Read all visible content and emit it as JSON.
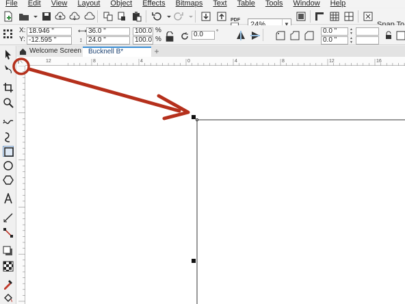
{
  "menu": [
    {
      "label": "File",
      "u": true
    },
    {
      "label": "Edit",
      "u": true
    },
    {
      "label": "View",
      "u": true
    },
    {
      "label": "Layout",
      "u": true
    },
    {
      "label": "Object",
      "u": true
    },
    {
      "label": "Effects",
      "u": true
    },
    {
      "label": "Bitmaps",
      "u": true
    },
    {
      "label": "Text",
      "u": true
    },
    {
      "label": "Table",
      "u": true
    },
    {
      "label": "Tools",
      "u": true
    },
    {
      "label": "Window",
      "u": true
    },
    {
      "label": "Help",
      "u": true
    }
  ],
  "toolbar": {
    "pdf_label": "PDF",
    "zoom_value": "24%",
    "snap_to_label": "Snap To"
  },
  "propbar": {
    "x_label": "X:",
    "x_value": "18.946 \"",
    "y_label": "Y:",
    "y_value": "-12.595 \"",
    "width_value": "36.0 \"",
    "height_value": "24.0 \"",
    "scale_x": "100.0",
    "scale_y": "100.0",
    "pct": "%",
    "rotation": "0.0",
    "corner_1": "0.0 \"",
    "corner_2": "0.0 \""
  },
  "tabs": {
    "home": "Welcome Screen",
    "doc": "Bucknell B*",
    "add": "+"
  },
  "rulers": {
    "h_labels": [
      "12",
      "8",
      "4",
      "0",
      "4",
      "8",
      "12",
      "16"
    ]
  },
  "colors": {
    "arrow": "#b5301c",
    "tab_accent": "#3b8fd6",
    "canvas": "#ffffff"
  }
}
